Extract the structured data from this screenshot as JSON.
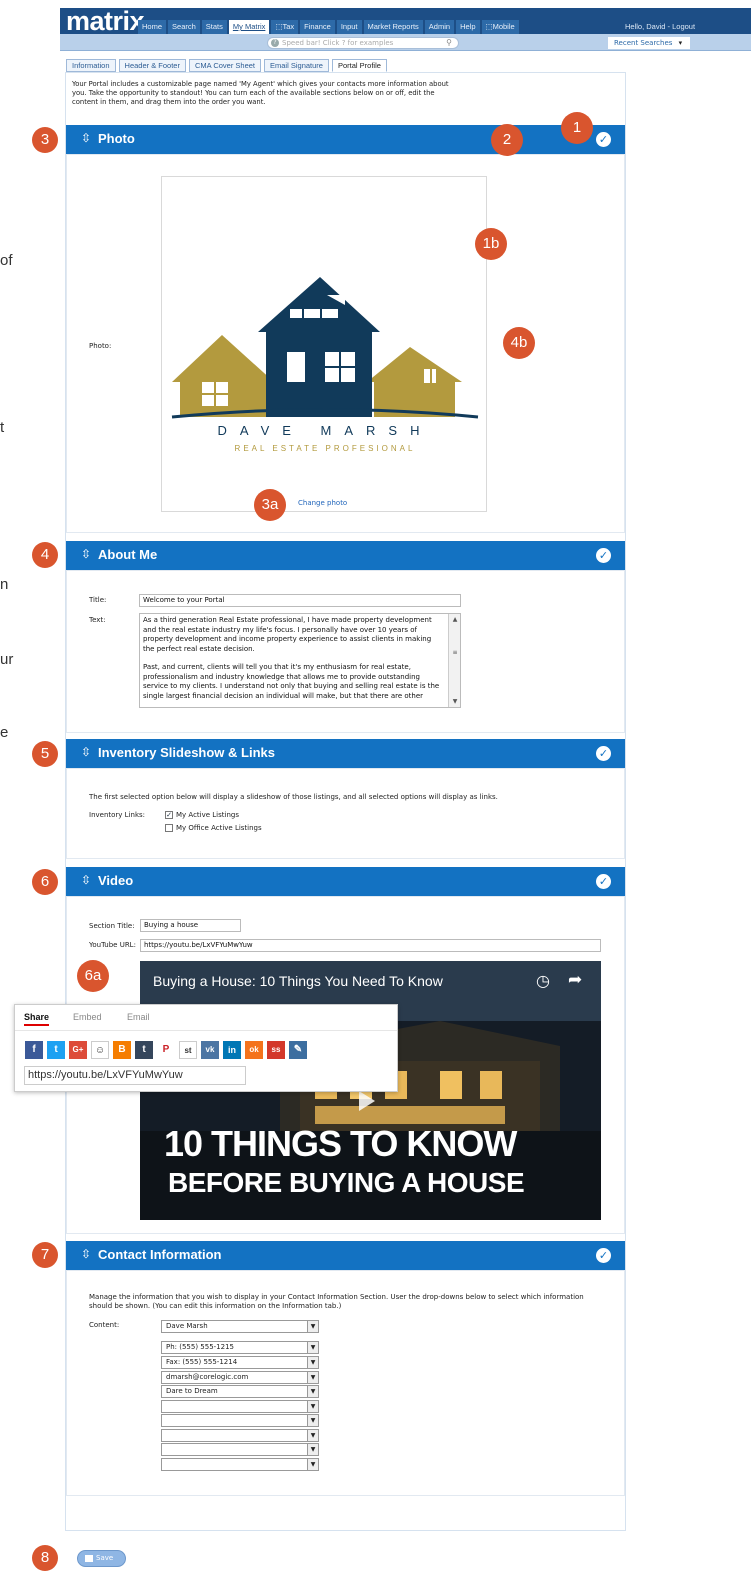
{
  "header": {
    "logo": "matrix",
    "nav": [
      "Home",
      "Search",
      "Stats",
      "My Matrix",
      "⬚Tax",
      "Finance",
      "Input",
      "Market Reports",
      "Admin",
      "Help",
      "⬚Mobile"
    ],
    "active_nav": "My Matrix",
    "greeting": "Hello, David - Logout",
    "speedbar_placeholder": "Speed bar! Click ? for examples",
    "recent_searches": "Recent Searches"
  },
  "tabs": [
    "Information",
    "Header & Footer",
    "CMA Cover Sheet",
    "Email Signature",
    "Portal Profile"
  ],
  "active_tab": "Portal Profile",
  "intro_text": "Your Portal includes a customizable page named 'My Agent' which gives your contacts more information about you. Take the opportunity to standout! You can turn each of the available sections below on or off, edit the content in them, and drag them into the order you want.",
  "edge_fragments": [
    "of",
    "t",
    "n",
    "ur",
    "e"
  ],
  "sections": {
    "photo": {
      "title": "Photo",
      "label": "Photo:",
      "logo_name": "DAVE MARSH",
      "logo_tagline": "REAL ESTATE PROFESIONAL",
      "change_link": "Change photo"
    },
    "about": {
      "title": "About Me",
      "title_label": "Title:",
      "title_value": "Welcome to your Portal",
      "text_label": "Text:",
      "text_p1": "As a third generation Real Estate professional, I have made property development and the real estate industry my life's focus. I personally have over 10 years of property development and income property experience to assist clients in making the perfect real estate decision.",
      "text_p2": "Past, and current, clients will tell you that it's my enthusiasm for real estate, professionalism and industry knowledge that allows me to provide outstanding service to my clients. I understand not only that buying and selling real estate is the single largest financial decision an individual will make, but that there are other"
    },
    "inventory": {
      "title": "Inventory Slideshow & Links",
      "description": "The first selected option below will display a slideshow of those listings, and all selected options will display as links.",
      "label": "Inventory Links:",
      "options": [
        {
          "label": "My Active Listings",
          "checked": true
        },
        {
          "label": "My Office Active Listings",
          "checked": false
        }
      ]
    },
    "video": {
      "title": "Video",
      "section_title_label": "Section Title:",
      "section_title_value": "Buying a house",
      "url_label": "YouTube URL:",
      "url_value": "https://youtu.be/LxVFYuMwYuw",
      "video_title": "Buying a House: 10 Things You Need To Know",
      "headline_1": "10 THINGS TO KNOW",
      "headline_2": "BEFORE BUYING A HOUSE",
      "share_tabs": [
        "Share",
        "Embed",
        "Email"
      ],
      "share_url": "https://youtu.be/LxVFYuMwYuw",
      "social_icons": [
        {
          "name": "facebook-icon",
          "glyph": "f",
          "color": "#3b5998"
        },
        {
          "name": "twitter-icon",
          "glyph": "t",
          "color": "#1da1f2"
        },
        {
          "name": "google-plus-icon",
          "glyph": "G+",
          "color": "#dd4b39"
        },
        {
          "name": "reddit-icon",
          "glyph": "☺",
          "color": "#ffffff"
        },
        {
          "name": "blogger-icon",
          "glyph": "B",
          "color": "#f57d00"
        },
        {
          "name": "tumblr-icon",
          "glyph": "t",
          "color": "#35465c"
        },
        {
          "name": "pinterest-icon",
          "glyph": "P",
          "color": "#cb2027"
        },
        {
          "name": "stumbleupon-icon",
          "glyph": "st",
          "color": "#ffffff"
        },
        {
          "name": "vk-icon",
          "glyph": "vk",
          "color": "#4c75a3"
        },
        {
          "name": "linkedin-icon",
          "glyph": "in",
          "color": "#0077b5"
        },
        {
          "name": "odnoklassniki-icon",
          "glyph": "ok",
          "color": "#f4731c"
        },
        {
          "name": "mixi-icon",
          "glyph": "ss",
          "color": "#d3382b"
        },
        {
          "name": "goo-icon",
          "glyph": "✎",
          "color": "#3c6ea0"
        }
      ]
    },
    "contact": {
      "title": "Contact Information",
      "description": "Manage the information that you wish to display in your Contact Information Section. User the drop-downs below to select which information should be shown. (You can edit this information on the Information tab.)",
      "label": "Content:",
      "first": "Dave Marsh",
      "rows": [
        "Ph: (555) 555-1215",
        "Fax: (555) 555-1214",
        "dmarsh@corelogic.com",
        "Dare to Dream",
        "",
        "",
        "",
        "",
        ""
      ]
    }
  },
  "save_label": "Save",
  "badges": {
    "b1": "1",
    "b2": "2",
    "b3": "3",
    "b1b": "1b",
    "b4b": "4b",
    "b3a": "3a",
    "b4": "4",
    "b5": "5",
    "b6": "6",
    "b6a": "6a",
    "b7": "7",
    "b8": "8"
  },
  "colors": {
    "accent": "#1372c2",
    "badge": "#d9552e",
    "logo_gold": "#b39a3e",
    "logo_navy": "#113a5a"
  }
}
